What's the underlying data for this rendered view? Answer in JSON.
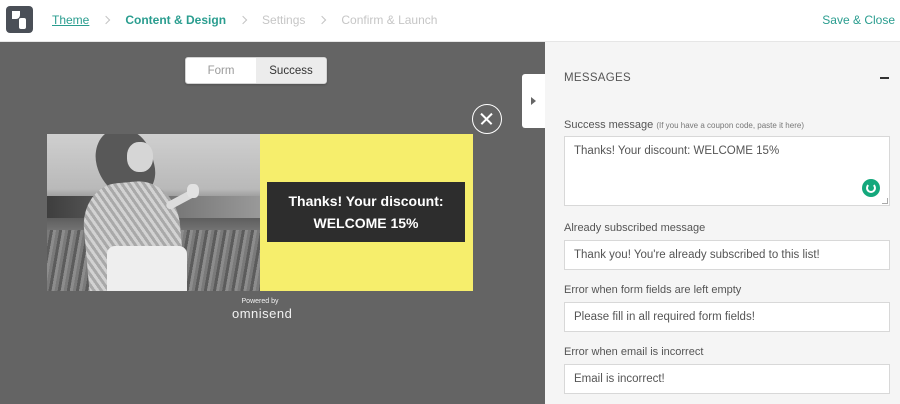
{
  "nav": {
    "steps": [
      "Theme",
      "Content & Design",
      "Settings",
      "Confirm & Launch"
    ],
    "save_close": "Save & Close"
  },
  "preview": {
    "tabs": [
      "Form",
      "Success"
    ],
    "selected_tab": "Success",
    "success_text": "Thanks! Your discount: WELCOME 15%",
    "powered_by": "Powered by",
    "brand": "omnisend",
    "popup_accent_color": "#f6ee6c"
  },
  "panel": {
    "section_title": "MESSAGES",
    "success_label": "Success message",
    "success_hint": "(If you have a coupon code, paste it here)",
    "success_value": "Thanks! Your discount: WELCOME 15%",
    "already_label": "Already subscribed message",
    "already_value": "Thank you! You're already subscribed to this list!",
    "empty_label": "Error when form fields are left empty",
    "empty_value": "Please fill in all required form fields!",
    "email_label": "Error when email is incorrect",
    "email_value": "Email is incorrect!"
  },
  "colors": {
    "accent": "#2a9d8f",
    "preview_bg": "#646464",
    "panel_bg": "#f5f5f5"
  }
}
